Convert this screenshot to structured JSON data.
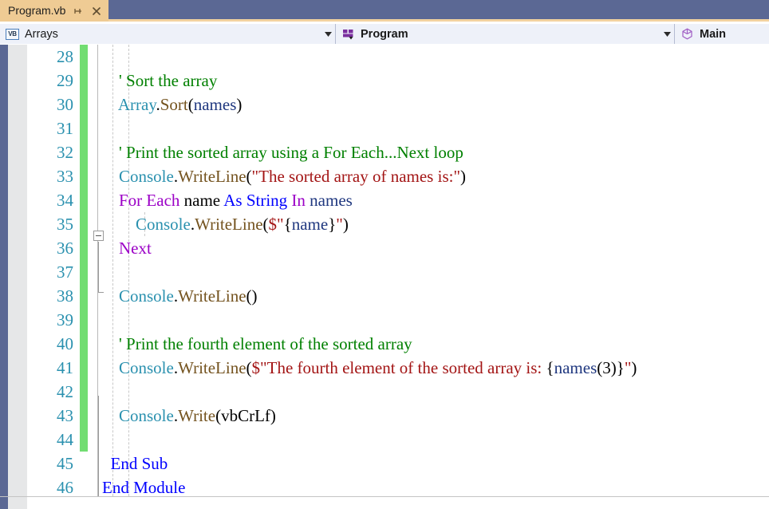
{
  "window": {
    "tab": {
      "title": "Program.vb",
      "pin_icon": "pin-icon",
      "close_icon": "close-icon"
    }
  },
  "navbar": {
    "project": {
      "icon": "vb-project-icon",
      "icon_text": "VB",
      "label": "Arrays",
      "dropdown_icon": "chevron-down-icon"
    },
    "type": {
      "icon": "module-icon",
      "label": "Program",
      "dropdown_icon": "chevron-down-icon"
    },
    "member": {
      "icon": "method-icon",
      "label": "Main",
      "dropdown_icon": "chevron-down-icon"
    }
  },
  "editor": {
    "first_line": 28,
    "line_numbers": [
      28,
      29,
      30,
      31,
      32,
      33,
      34,
      35,
      36,
      37,
      38,
      39,
      40,
      41,
      42,
      43,
      44,
      45,
      46
    ],
    "colors": {
      "comment": "#008000",
      "keyword": "#9b00c6",
      "keyword_blue": "#0000ff",
      "class": "#2b91af",
      "method": "#74531f",
      "string": "#a31515",
      "identifier": "#1f377f",
      "line_number": "#2b91af",
      "change_bar": "#72dd72",
      "tab_background": "#efcb94",
      "titlebar": "#5b6894",
      "navbar": "#eef1f9"
    },
    "plain_text_lines": [
      "",
      "        ' Sort the array",
      "        Array.Sort(names)",
      "",
      "        ' Print the sorted array using a For Each...Next loop",
      "        Console.WriteLine(\"The sorted array of names is:\")",
      "        For Each name As String In names",
      "            Console.WriteLine($\"{name}\")",
      "        Next",
      "",
      "        Console.WriteLine()",
      "",
      "        ' Print the fourth element of the sorted array",
      "        Console.WriteLine($\"The fourth element of the sorted array is: {names(3)}\")",
      "",
      "        Console.Write(vbCrLf)",
      "",
      "    End Sub",
      "End Module"
    ],
    "outlining": {
      "collapse_glyph_line": 34,
      "collapse_glyph_state": "expanded"
    }
  }
}
